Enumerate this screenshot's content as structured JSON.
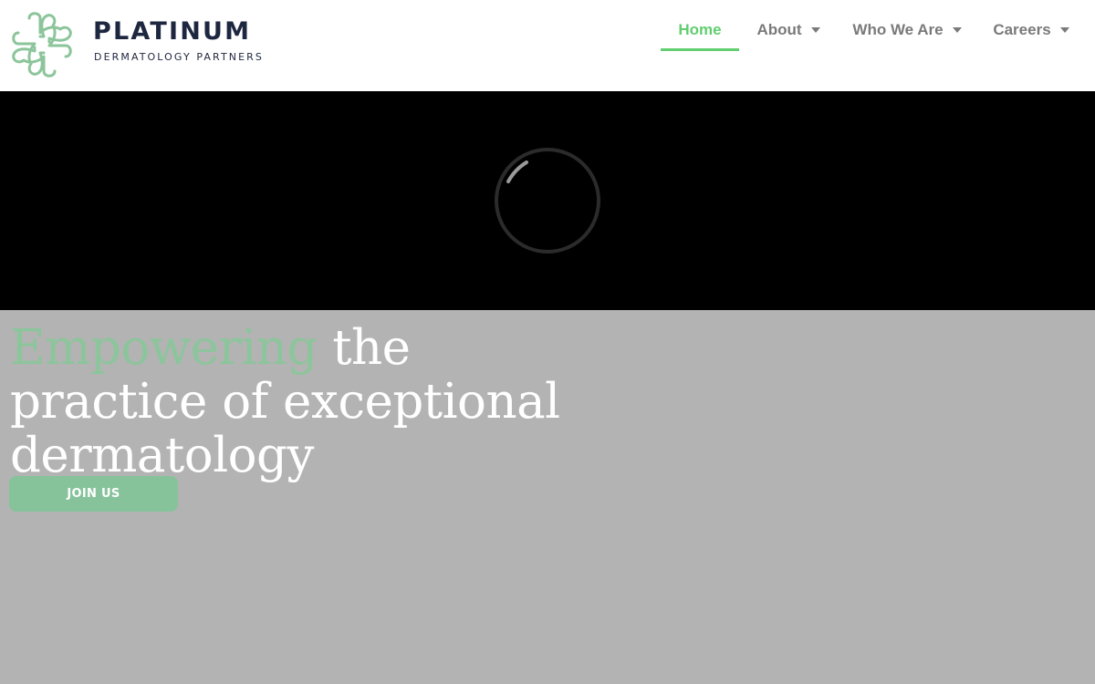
{
  "brand": {
    "name": "PLATINUM",
    "tagline": "DERMATOLOGY PARTNERS",
    "logo_icon": "platinum-knot-logo-icon",
    "accent_color": "#8cc59b",
    "navy_color": "#1e2740"
  },
  "nav": {
    "items": [
      {
        "label": "Home",
        "active": true
      },
      {
        "label": "About",
        "has_dropdown": true
      },
      {
        "label": "Who We Are",
        "has_dropdown": true
      },
      {
        "label": "Careers",
        "has_dropdown": true
      }
    ],
    "active_color": "#61ce70",
    "dropdown_icon": "caret-down-icon"
  },
  "video": {
    "loading_icon": "loading-spinner-icon"
  },
  "hero": {
    "accent_word": "Empowering",
    "line1_rest": " the",
    "line2": "practice of exceptional",
    "line3": "dermatology",
    "cta_label": "JOIN US"
  }
}
